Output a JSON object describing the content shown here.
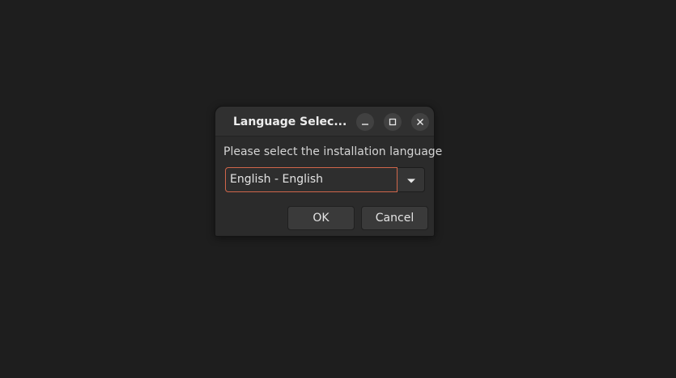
{
  "dialog": {
    "title": "Language Selec...",
    "prompt": "Please select the installation language",
    "language_select": {
      "value": "English - English"
    },
    "ok_label": "OK",
    "cancel_label": "Cancel",
    "window_controls": {
      "minimize_icon": "minimize-icon",
      "maximize_icon": "maximize-icon",
      "close_icon": "close-icon"
    }
  },
  "colors": {
    "desktop_background": "#1e1e1e",
    "dialog_background": "#2b2b2b",
    "focus_border": "#d0664a"
  }
}
